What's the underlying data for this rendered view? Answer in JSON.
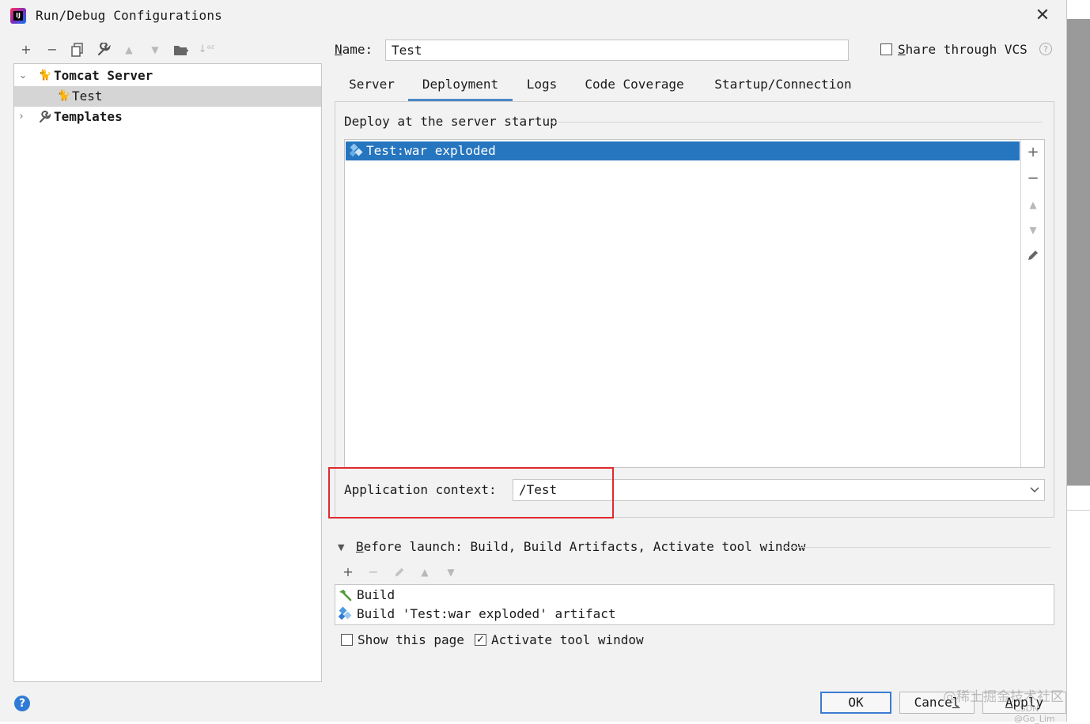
{
  "window": {
    "title": "Run/Debug Configurations",
    "logo_text": "IJ"
  },
  "toolbar": {
    "items": [
      {
        "name": "add",
        "glyph": "+"
      },
      {
        "name": "remove",
        "glyph": "−"
      },
      {
        "name": "copy",
        "glyph": "⧉"
      },
      {
        "name": "edit-defaults",
        "glyph": "🔧"
      },
      {
        "name": "move-up",
        "glyph": "▲"
      },
      {
        "name": "move-down",
        "glyph": "▼"
      },
      {
        "name": "new-folder",
        "glyph": "📁"
      },
      {
        "name": "sort",
        "glyph": "↓ᵃᶻ"
      }
    ]
  },
  "tree": {
    "items": [
      {
        "label": "Tomcat Server",
        "expanded": true
      },
      {
        "label": "Test",
        "selected": true
      },
      {
        "label": "Templates",
        "expanded": false
      }
    ]
  },
  "form": {
    "name_label_underlined": "N",
    "name_label_rest": "ame:",
    "name_value": "Test",
    "share_checked": false,
    "share_label_underlined": "S",
    "share_label_rest": "hare through VCS",
    "help_glyph": "?"
  },
  "tabs": [
    {
      "label": "Server",
      "active": false
    },
    {
      "label": "Deployment",
      "active": true
    },
    {
      "label": "Logs",
      "active": false
    },
    {
      "label": "Code Coverage",
      "active": false
    },
    {
      "label": "Startup/Connection",
      "active": false
    }
  ],
  "deployment": {
    "section_title": "Deploy at the server startup",
    "artifacts": [
      "Test:war exploded"
    ],
    "list_tools": [
      {
        "name": "add",
        "glyph": "+",
        "enabled": true
      },
      {
        "name": "remove",
        "glyph": "−",
        "enabled": true
      },
      {
        "name": "move-up",
        "glyph": "▲",
        "enabled": false
      },
      {
        "name": "move-down",
        "glyph": "▼",
        "enabled": false
      },
      {
        "name": "edit",
        "glyph": "✎",
        "enabled": true
      }
    ],
    "context_label": "Application context:",
    "context_value": "/Test"
  },
  "before_launch": {
    "title_underlined": "B",
    "title_rest": "efore launch: Build, Build Artifacts, Activate tool window",
    "tools": [
      {
        "name": "add",
        "glyph": "+",
        "enabled": true
      },
      {
        "name": "remove",
        "glyph": "−",
        "enabled": false
      },
      {
        "name": "edit",
        "glyph": "✎",
        "enabled": false
      },
      {
        "name": "move-up",
        "glyph": "▲",
        "enabled": false
      },
      {
        "name": "move-down",
        "glyph": "▼",
        "enabled": false
      }
    ],
    "tasks": [
      "Build",
      "Build 'Test:war exploded' artifact"
    ],
    "show_page_label": "Show this page",
    "show_page_checked": false,
    "activate_label": "Activate tool window",
    "activate_checked": true
  },
  "buttons": {
    "ok": "OK",
    "cancel_underlined_prefix": "Cance",
    "cancel_underlined": "l",
    "apply_underlined": "A",
    "apply_rest": "pply"
  },
  "watermark": {
    "line1": "@稀土掘金技术社区",
    "line2": "CSDN @Go_Lim"
  },
  "colors": {
    "selection": "#2675bf",
    "highlight_box": "#e0292e",
    "tab_underline": "#4a88c7",
    "help": "#2f7bd6"
  }
}
